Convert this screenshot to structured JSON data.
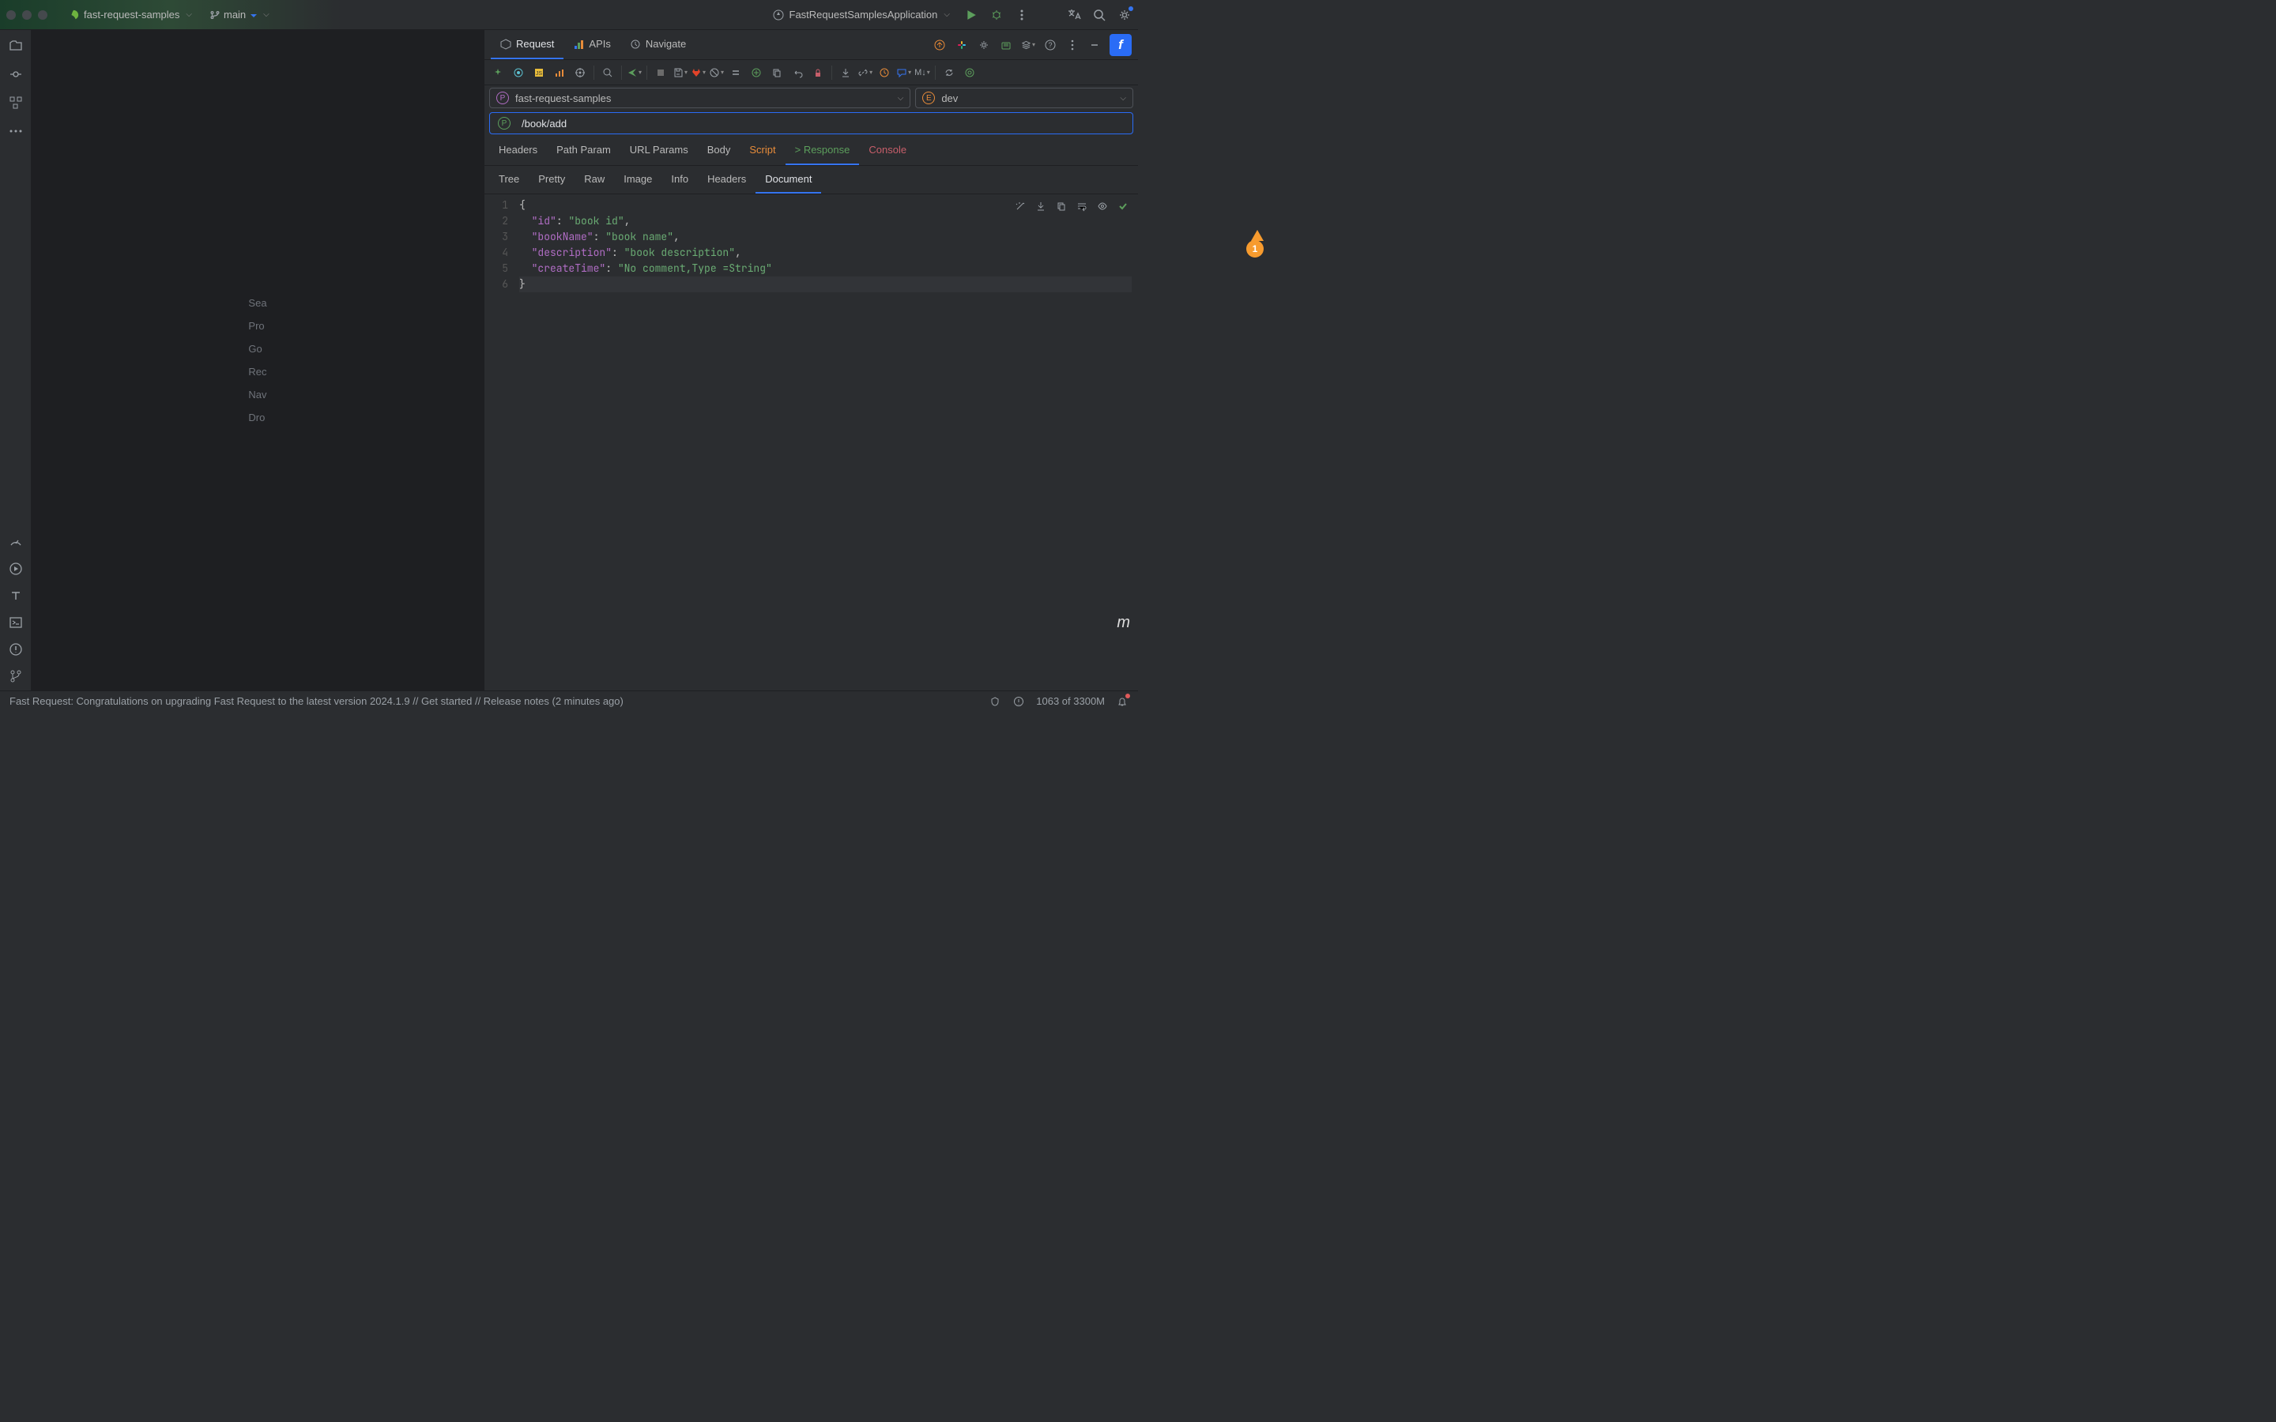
{
  "top": {
    "project": "fast-request-samples",
    "branch": "main",
    "run_config": "FastRequestSamplesApplication"
  },
  "editor_placeholder": [
    "Sea",
    "Pro",
    "Go",
    "Rec",
    "Nav",
    "Dro"
  ],
  "panel": {
    "tabs": [
      "Request",
      "APIs",
      "Navigate"
    ],
    "active_tab": 0
  },
  "selectors": {
    "project": {
      "badge": "P",
      "label": "fast-request-samples"
    },
    "env": {
      "badge": "E",
      "label": "dev"
    }
  },
  "url": {
    "method": "P",
    "path": "/book/add"
  },
  "sub_tabs": [
    "Headers",
    "Path Param",
    "URL Params",
    "Body",
    "Script",
    "> Response",
    "Console"
  ],
  "sub_tab_active": 5,
  "view_tabs": [
    "Tree",
    "Pretty",
    "Raw",
    "Image",
    "Info",
    "Headers",
    "Document"
  ],
  "view_tab_active": 6,
  "code": {
    "lines": [
      {
        "n": "1",
        "tokens": [
          {
            "t": "punc",
            "v": "{"
          }
        ]
      },
      {
        "n": "2",
        "tokens": [
          {
            "t": "key",
            "v": "\"id\""
          },
          {
            "t": "punc",
            "v": ": "
          },
          {
            "t": "str",
            "v": "\"book id\""
          },
          {
            "t": "punc",
            "v": ","
          }
        ]
      },
      {
        "n": "3",
        "tokens": [
          {
            "t": "key",
            "v": "\"bookName\""
          },
          {
            "t": "punc",
            "v": ": "
          },
          {
            "t": "str",
            "v": "\"book name\""
          },
          {
            "t": "punc",
            "v": ","
          }
        ]
      },
      {
        "n": "4",
        "tokens": [
          {
            "t": "key",
            "v": "\"description\""
          },
          {
            "t": "punc",
            "v": ": "
          },
          {
            "t": "str",
            "v": "\"book description\""
          },
          {
            "t": "punc",
            "v": ","
          }
        ]
      },
      {
        "n": "5",
        "tokens": [
          {
            "t": "key",
            "v": "\"createTime\""
          },
          {
            "t": "punc",
            "v": ": "
          },
          {
            "t": "str",
            "v": "\"No comment,Type =String\""
          }
        ]
      },
      {
        "n": "6",
        "tokens": [
          {
            "t": "punc",
            "v": "}"
          }
        ],
        "current": true
      }
    ]
  },
  "annotation": {
    "num": "1"
  },
  "status": {
    "message": "Fast Request: Congratulations on upgrading Fast Request to the latest version 2024.1.9 // Get started // Release notes (2 minutes ago)",
    "memory": "1063 of 3300M"
  },
  "watermark": "m"
}
